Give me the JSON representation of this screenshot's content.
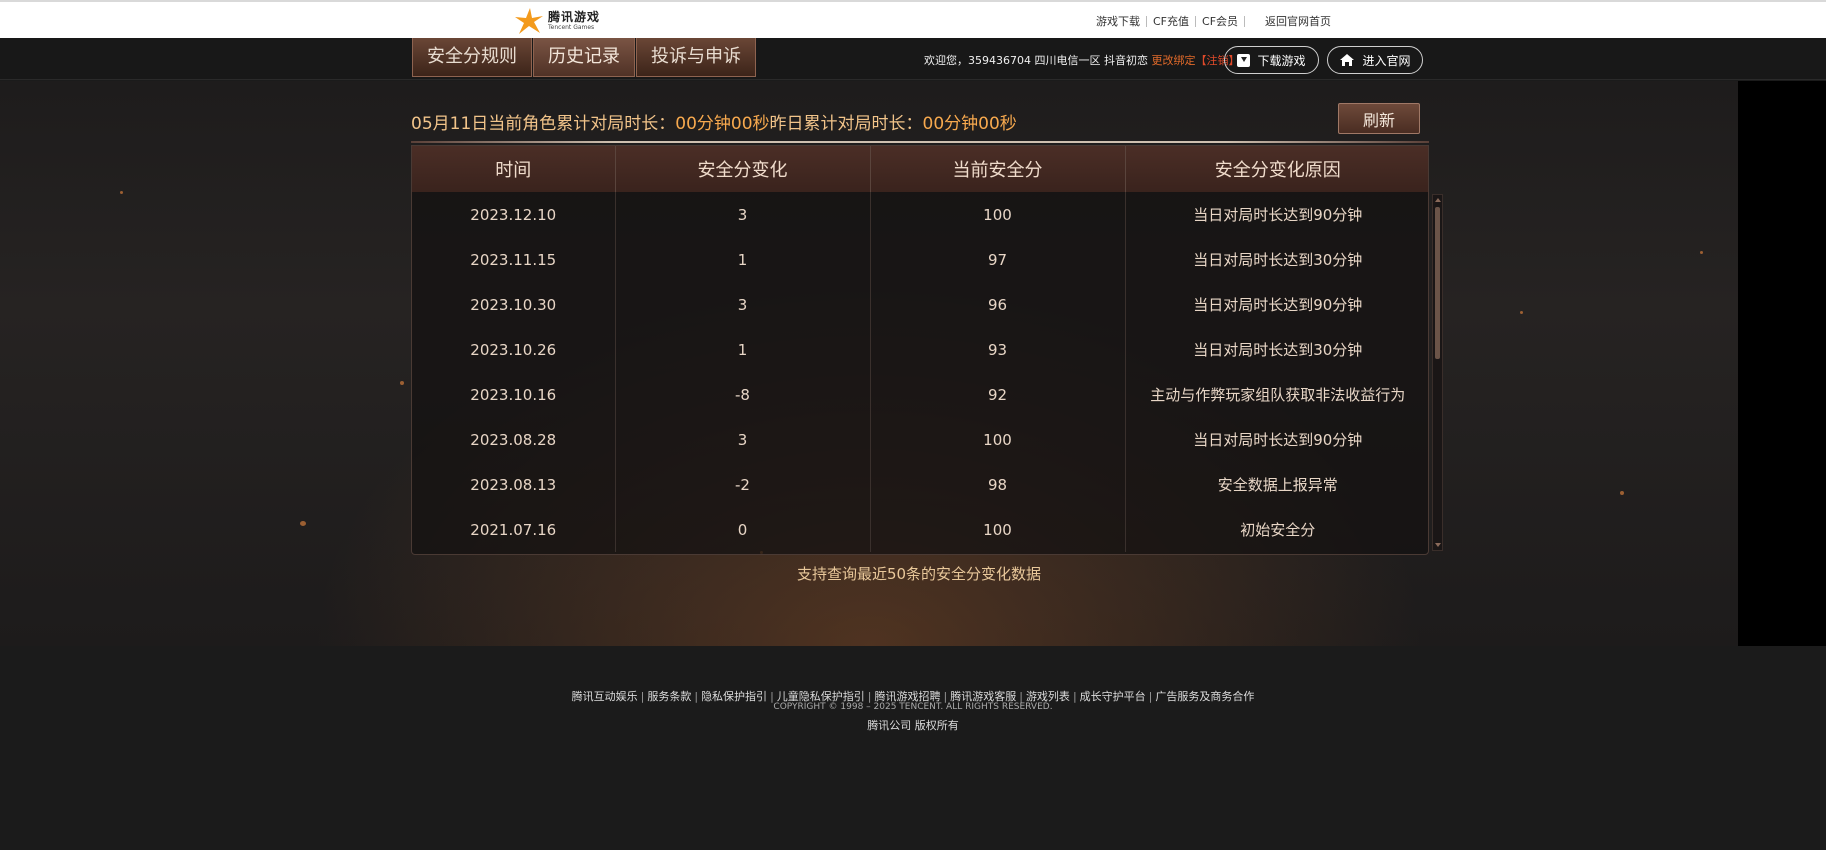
{
  "header": {
    "logo_cn": "腾讯游戏",
    "logo_en": "Tencent Games",
    "links": [
      "游戏下载",
      "CF充值",
      "CF会员",
      "返回官网首页"
    ]
  },
  "nav": {
    "tabs": [
      "安全分规则",
      "历史记录",
      "投诉与申诉"
    ],
    "active_tab": 1,
    "welcome": "欢迎您，359436704 四川电信一区 抖音初恋 ",
    "change_bind": "更改绑定",
    "logout": "【注销】",
    "download_btn": "下载游戏",
    "home_btn": "进入官网"
  },
  "main": {
    "summary_prefix": "05月11日当前角色累计对局时长：",
    "summary_value1": "00分钟00秒",
    "summary_mid": "昨日累计对局时长：",
    "summary_value2": "00分钟00秒",
    "refresh_btn": "刷新",
    "table": {
      "headers": [
        "时间",
        "安全分变化",
        "当前安全分",
        "安全分变化原因"
      ],
      "rows": [
        [
          "2023.12.10",
          "3",
          "100",
          "当日对局时长达到90分钟"
        ],
        [
          "2023.11.15",
          "1",
          "97",
          "当日对局时长达到30分钟"
        ],
        [
          "2023.10.30",
          "3",
          "96",
          "当日对局时长达到90分钟"
        ],
        [
          "2023.10.26",
          "1",
          "93",
          "当日对局时长达到30分钟"
        ],
        [
          "2023.10.16",
          "-8",
          "92",
          "主动与作弊玩家组队获取非法收益行为"
        ],
        [
          "2023.08.28",
          "3",
          "100",
          "当日对局时长达到90分钟"
        ],
        [
          "2023.08.13",
          "-2",
          "98",
          "安全数据上报异常"
        ],
        [
          "2021.07.16",
          "0",
          "100",
          "初始安全分"
        ]
      ]
    },
    "note": "支持查询最近50条的安全分变化数据"
  },
  "footer": {
    "links": [
      "腾讯互动娱乐",
      "服务条款",
      "隐私保护指引",
      "儿童隐私保护指引",
      "腾讯游戏招聘",
      "腾讯游戏客服",
      "游戏列表",
      "成长守护平台",
      "广告服务及商务合作"
    ],
    "copyright": "COPYRIGHT © 1998 – 2025 TENCENT. ALL RIGHTS RESERVED.",
    "company": "腾讯公司 版权所有"
  },
  "colors": {
    "accent_orange": "#f2c48a",
    "tab_brown": "#6a4636",
    "link_red": "#e04a2a"
  }
}
